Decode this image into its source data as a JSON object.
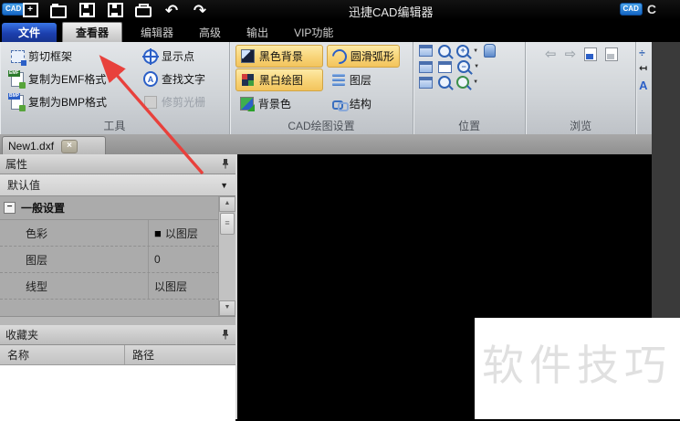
{
  "colors": {
    "accent_highlight": "#f8d478",
    "highlight_border": "#d0a445",
    "ribbon_bg": "#cfd3d7",
    "titlebar_bg": "#000000",
    "menu_file_blue": "#1c3fae",
    "annotation_red": "#e8413c",
    "canvas_black": "#000000",
    "panel_gray": "#b3b3b3",
    "behind_window_gray": "#3a3a3a"
  },
  "icons": {
    "close": "×",
    "dropdown": "▼",
    "scroll_up": "▲",
    "scroll_down": "▼",
    "grip": "≡",
    "collapse": "−",
    "swatch": "■",
    "nav_back": "⇦",
    "nav_forward": "⇨",
    "undo": "↶",
    "redo": "↷",
    "new_plus": "+",
    "zoom_in": "+",
    "zoom_out": "−",
    "partial_dim": "÷",
    "partial_measure": "↤",
    "partial_text": "A"
  },
  "title_bar": {
    "logo": "CAD",
    "title": "迅捷CAD编辑器",
    "overlap_logo": "CAD",
    "overlap_text": "C"
  },
  "menu": {
    "items": [
      {
        "label": "文件"
      },
      {
        "label": "查看器"
      },
      {
        "label": "编辑器"
      },
      {
        "label": "高级"
      },
      {
        "label": "输出"
      },
      {
        "label": "VIP功能"
      }
    ]
  },
  "ribbon": {
    "groups": [
      {
        "label": "工具",
        "buttons": [
          {
            "label": "剪切框架"
          },
          {
            "label": "复制为EMF格式",
            "badge": "EMF"
          },
          {
            "label": "复制为BMP格式",
            "badge": "BMP"
          },
          {
            "label": "显示点"
          },
          {
            "label": "查找文字",
            "glyph": "A"
          },
          {
            "label": "修剪光栅",
            "state": "disabled"
          }
        ]
      },
      {
        "label": "CAD绘图设置",
        "buttons": [
          {
            "label": "黑色背景",
            "state": "active"
          },
          {
            "label": "黑白绘图",
            "state": "active"
          },
          {
            "label": "背景色"
          },
          {
            "label": "圆滑弧形",
            "state": "active"
          },
          {
            "label": "图层"
          },
          {
            "label": "结构"
          }
        ]
      },
      {
        "label": "位置"
      },
      {
        "label": "浏览"
      }
    ]
  },
  "tabs": {
    "document": "New1.dxf"
  },
  "properties": {
    "title": "属性",
    "preset": "默认值",
    "group": "一般设置",
    "rows": [
      {
        "label": "色彩",
        "value": "以图层",
        "swatch": "#000000"
      },
      {
        "label": "图层",
        "value": "0"
      },
      {
        "label": "线型",
        "value": "以图层"
      }
    ]
  },
  "favorites": {
    "title": "收藏夹",
    "columns": [
      {
        "label": "名称"
      },
      {
        "label": "路径"
      }
    ]
  },
  "watermark": {
    "text": "软件技巧"
  }
}
